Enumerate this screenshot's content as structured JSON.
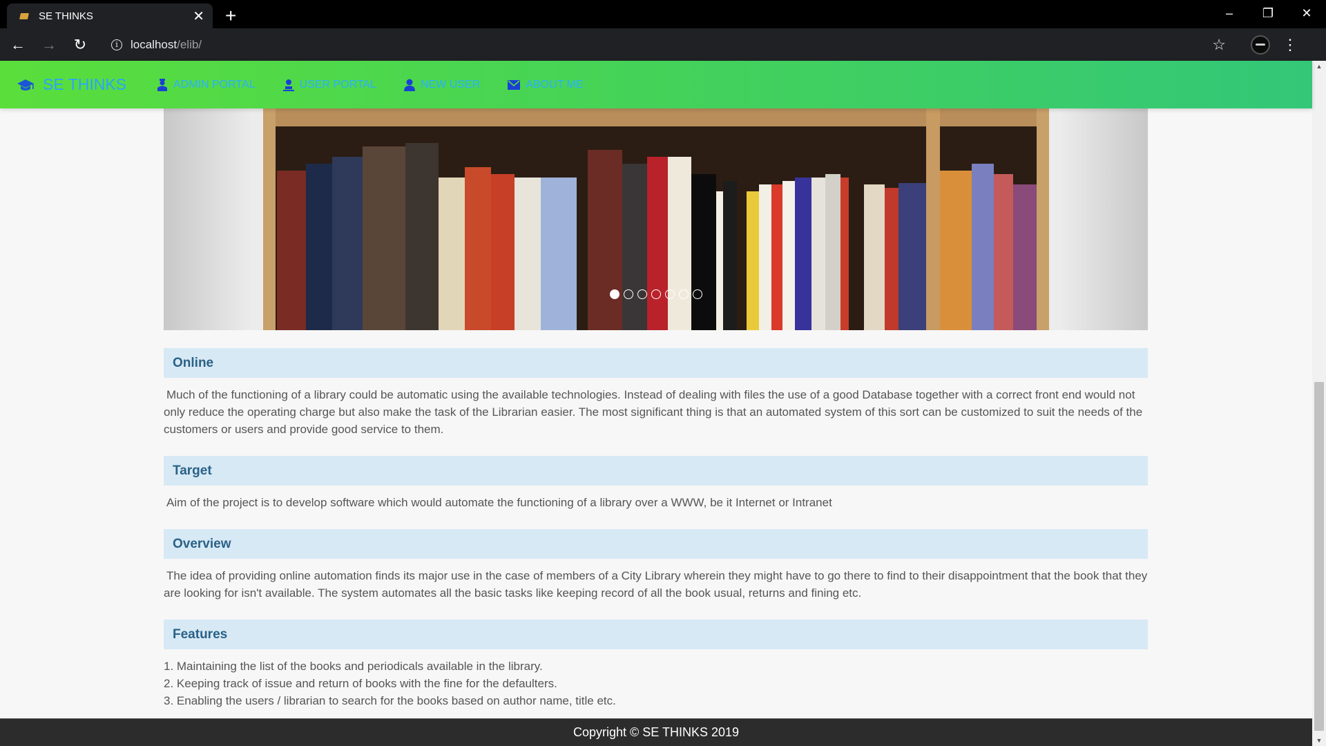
{
  "browser": {
    "tab_title": "SE THINKS",
    "url_host": "localhost",
    "url_path": "/elib/"
  },
  "nav": {
    "brand": "SE THINKS",
    "links": [
      {
        "label": "ADMIN PORTAL",
        "icon": "admin-icon"
      },
      {
        "label": "USER PORTAL",
        "icon": "user-icon"
      },
      {
        "label": "NEW USER",
        "icon": "new-user-icon"
      },
      {
        "label": "ABOUT ME",
        "icon": "envelope-icon"
      }
    ],
    "colors": {
      "gradient_start": "#5ade3c",
      "gradient_end": "#33c778",
      "link": "#2bb0ff"
    }
  },
  "carousel": {
    "image": "bookshelf-photo",
    "slide_count": 7,
    "active_index": 0
  },
  "sections": [
    {
      "heading": "Online",
      "text": "Much of the functioning of a library could be automatic using the available technologies. Instead of dealing with files the use of a good Database together with a correct front end would not only reduce the operating charge but also make the task of the Librarian easier. The most significant thing is that an automated system of this sort can be customized to suit the needs of the customers or users and provide good service to them."
    },
    {
      "heading": "Target",
      "text": "Aim of the project is to develop software which would automate the functioning of a library over a WWW, be it Internet or Intranet"
    },
    {
      "heading": "Overview",
      "text": "The idea of providing online automation finds its major use in the case of members of a City Library wherein they might have to go there to find to their disappointment that the book that they are looking for isn't available. The system automates all the basic tasks like keeping record of all the book usual, returns and fining etc."
    },
    {
      "heading": "Features",
      "items": [
        "1. Maintaining the list of the books and periodicals available in the library.",
        "2. Keeping track of issue and return of books with the fine for the defaulters.",
        "3. Enabling the users / librarian to search for the books based on author name, title etc."
      ]
    }
  ],
  "footer": {
    "text": "Copyright © SE THINKS 2019"
  }
}
